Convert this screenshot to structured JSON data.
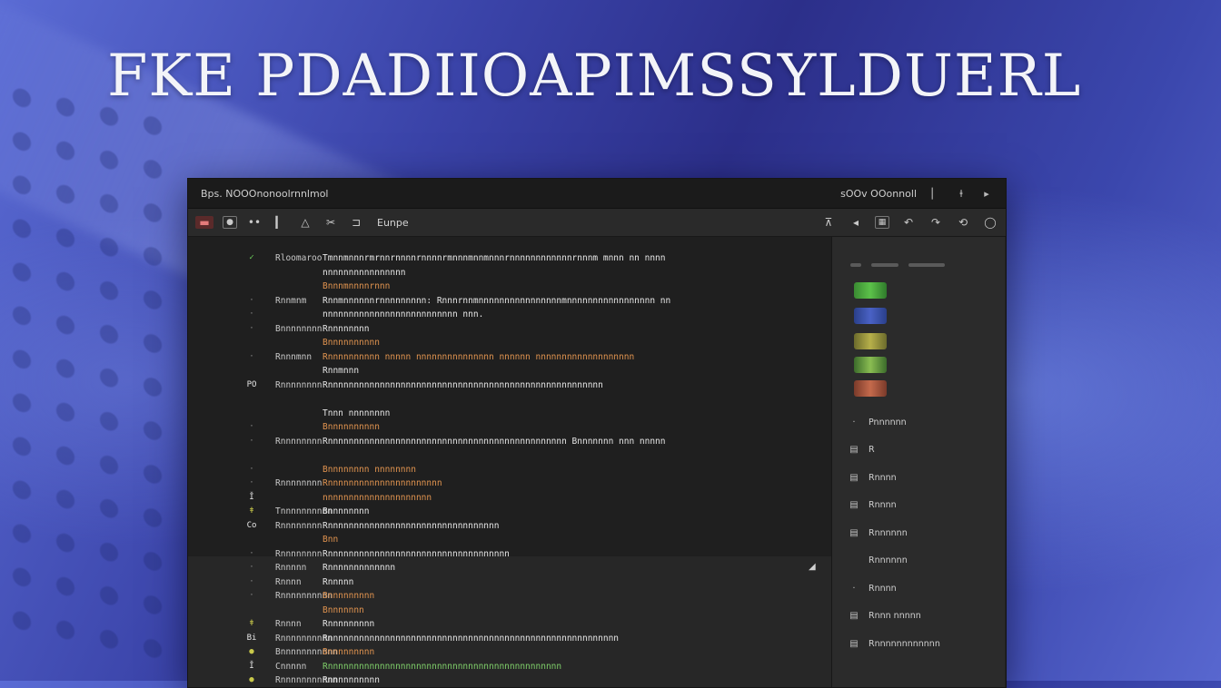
{
  "banner": {
    "title": "FKE PDADIIOAPIMSSYLDUERL"
  },
  "window": {
    "title": "Bps. NOOOnonoolrnnlmol",
    "title_right": "sOOv OOonnoll"
  },
  "toolbar": {
    "tab_label": "Eunpe"
  },
  "editor": {
    "lines": [
      {
        "gutter": "✓",
        "gutter_color": "green",
        "label": "Rloomaroo",
        "code": "Tmnnmnnnrmrnnrnnnnrnnnnrmnnnmnnmnnnrnnnnnnnnnnnnrnnnm mnnn nn nnnn",
        "code_color": "white"
      },
      {
        "gutter": "",
        "gutter_color": "",
        "label": "",
        "code": "nnnnnnnnnnnnnnnn",
        "code_color": "white"
      },
      {
        "gutter": "",
        "gutter_color": "",
        "label": "",
        "code": "Bnnnmnnnnrnnn",
        "code_color": "orange"
      },
      {
        "gutter": "·",
        "gutter_color": "dot",
        "label": "Rnnmnm",
        "code": "Rnnmnnnnnnrnnnnnnnnn: Rnnnrnnmnnnnnnnnnnnnnnnnmnnnnnnnnnnnnnnnnn nn",
        "code_color": "white"
      },
      {
        "gutter": "·",
        "gutter_color": "dot",
        "label": "",
        "code": "nnnnnnnnnnnnnnnnnnnnnnnnnn   nnn.",
        "code_color": "white"
      },
      {
        "gutter": "·",
        "gutter_color": "dot",
        "label": "Bnnnnnnnn",
        "code": "Rnnnnnnnn",
        "code_color": "white"
      },
      {
        "gutter": "",
        "gutter_color": "",
        "label": "",
        "code": "Bnnnnnnnnnn",
        "code_color": "orange"
      },
      {
        "gutter": "·",
        "gutter_color": "dot",
        "label": "Rnnnmnn",
        "code": "Rnnnnnnnnnn  nnnnn nnnnnnnnnnnnnnn nnnnnn nnnnnnnnnnnnnnnnnnn",
        "code_color": "orange"
      },
      {
        "gutter": "",
        "gutter_color": "",
        "label": "",
        "code": "Rnnmnnn",
        "code_color": "white"
      },
      {
        "gutter": "PO",
        "gutter_color": "white",
        "label": "Rnnnnnnnn",
        "code": "Rnnnnnnnnnnnnnnnnnnnnnnnnnnnnnnnnnnnnnnnnnnnnnnnnnnnnn",
        "code_color": "white"
      },
      {
        "gutter": "",
        "gutter_color": "",
        "label": "",
        "code": "",
        "code_color": "white"
      },
      {
        "gutter": "",
        "gutter_color": "",
        "label": "",
        "code": "Tnnn nnnnnnnn",
        "code_color": "white"
      },
      {
        "gutter": "·",
        "gutter_color": "dot",
        "label": "",
        "code": "Bnnnnnnnnnn",
        "code_color": "orange"
      },
      {
        "gutter": "·",
        "gutter_color": "dot",
        "label": "Rnnnnnnnn",
        "code": "Rnnnnnnnnnnnnnnnnnnnnnnnnnnnnnnnnnnnnnnnnnnnnnn Bnnnnnnn nnn nnnnn",
        "code_color": "white"
      },
      {
        "gutter": "",
        "gutter_color": "",
        "label": "",
        "code": "",
        "code_color": "white"
      },
      {
        "gutter": "·",
        "gutter_color": "dot",
        "label": "",
        "code": "Bnnnnnnnn nnnnnnnn",
        "code_color": "orange"
      },
      {
        "gutter": "·",
        "gutter_color": "dot",
        "label": "Rnnnnnnnn",
        "code": "Rnnnnnnnnnnnnnnnnnnnnnn",
        "code_color": "orange"
      },
      {
        "gutter": "Ǐ",
        "gutter_color": "white",
        "label": "",
        "code": "nnnnnnnnnnnnnnnnnnnnn",
        "code_color": "orange"
      },
      {
        "gutter": "ǂ",
        "gutter_color": "yellow",
        "label": "Tnnnnnnnnnn",
        "code": "Bnnnnnnnn",
        "code_color": "white"
      },
      {
        "gutter": "Co",
        "gutter_color": "white",
        "label": "Rnnnnnnnn",
        "code": "Rnnnnnnnnnnnnnnnnnnnnnnnnnnnnnnnnn",
        "code_color": "white"
      },
      {
        "gutter": "",
        "gutter_color": "",
        "label": "",
        "code": "Bnn",
        "code_color": "orange"
      },
      {
        "gutter": "·",
        "gutter_color": "dot",
        "label": "Rnnnnnnnn",
        "code": "Rnnnnnnnnnnnnnnnnnnnnnnnnnnnnnnnnnnn",
        "code_color": "white"
      },
      {
        "gutter": "·",
        "gutter_color": "dot",
        "label": "Rnnnnn",
        "code": "Rnnnnnnnnnnnnn",
        "code_color": "white"
      },
      {
        "gutter": "·",
        "gutter_color": "dot",
        "label": "Rnnnn",
        "code": "Rnnnnn",
        "code_color": "white"
      },
      {
        "gutter": "·",
        "gutter_color": "dot",
        "label": "Rnnnnnnnnnn",
        "code": "Bnnnnnnnnn",
        "code_color": "orange"
      },
      {
        "gutter": "",
        "gutter_color": "",
        "label": "",
        "code": "Bnnnnnnn",
        "code_color": "orange"
      },
      {
        "gutter": "ǂ",
        "gutter_color": "yellow",
        "label": "Rnnnn",
        "code": "Rnnnnnnnnn",
        "code_color": "white"
      },
      {
        "gutter": "Bi",
        "gutter_color": "white",
        "label": "Rnnnnnnnnnn",
        "code": "Rnnnnnnnnnnnnnnnnnnnnnnnnnnnnnnnnnnnnnnnnnnnnnnnnnnnnnnnn",
        "code_color": "white"
      },
      {
        "gutter": "●",
        "gutter_color": "yellow",
        "label": "Bnnnnnnnnnnn",
        "code": "Bnnnnnnnnn",
        "code_color": "orange"
      },
      {
        "gutter": "Ǐ",
        "gutter_color": "white",
        "label": "Cnnnnn",
        "code": "Rnnnnnnnnnnnnnnnnnnnnnnnnnnnnnnnnnnnnnnnnnnnnn",
        "code_color": "green"
      },
      {
        "gutter": "●",
        "gutter_color": "yellow",
        "label": "Rnnnnnnnnnnn",
        "code": "Rnnnnnnnnnn",
        "code_color": "white"
      }
    ]
  },
  "sidebar": {
    "items": [
      {
        "icon": "·",
        "label": "Pnnnnnn"
      },
      {
        "icon": "▤",
        "label": "R"
      },
      {
        "icon": "▤",
        "label": "Rnnnn"
      },
      {
        "icon": "▤",
        "label": "Rnnnn"
      },
      {
        "icon": "▤",
        "label": "Rnnnnnn"
      },
      {
        "icon": "",
        "label": "Rnnnnnn"
      },
      {
        "icon": "·",
        "label": "Rnnnn"
      },
      {
        "icon": "▤",
        "label": "Rnnn nnnnn"
      },
      {
        "icon": "▤",
        "label": "Rnnnnnnnnnnnn"
      }
    ]
  },
  "colors": {
    "accent_green": "#6ed35c",
    "code_orange": "#e0934f",
    "editor_bg": "#1f1f1f"
  }
}
